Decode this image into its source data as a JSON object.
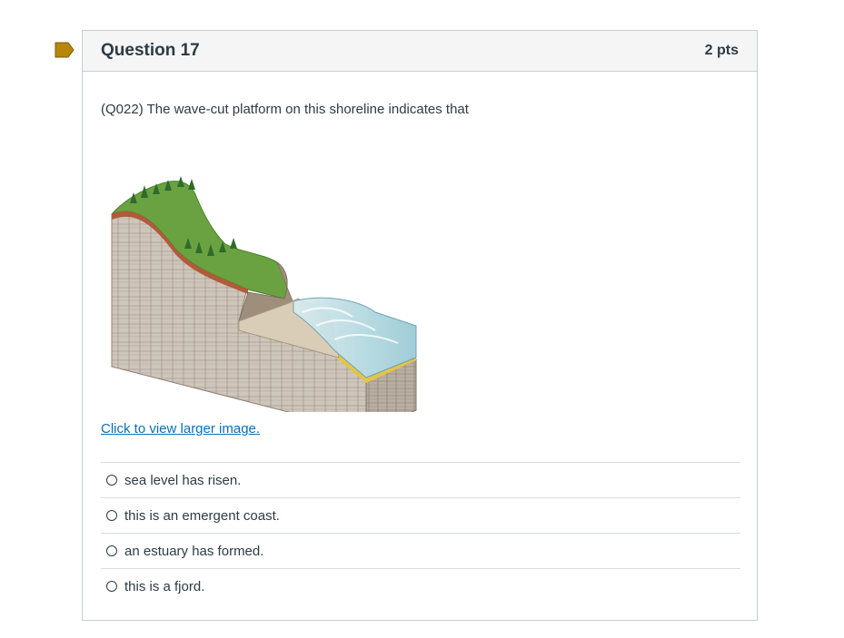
{
  "question": {
    "title": "Question 17",
    "points": "2 pts",
    "text": "(Q022) The wave-cut platform on this shoreline indicates that",
    "image_link_label": "Click to view larger image.",
    "answers": [
      {
        "label": "sea level has risen."
      },
      {
        "label": "this is an emergent coast."
      },
      {
        "label": "an estuary has formed."
      },
      {
        "label": "this is a fjord."
      }
    ]
  },
  "colors": {
    "flag": "#b8860b",
    "link": "#0b6fb7",
    "text": "#2d3b45",
    "border": "#c7cdd1",
    "header_bg": "#f5f5f5"
  }
}
